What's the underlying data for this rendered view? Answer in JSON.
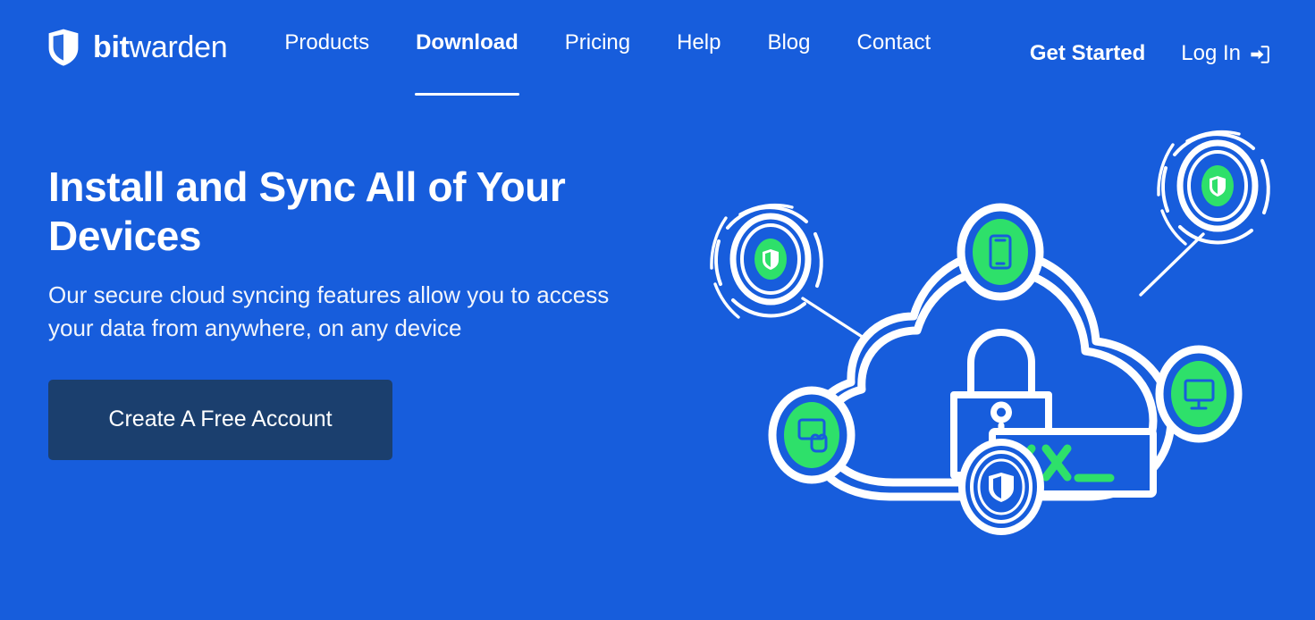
{
  "theme": {
    "background_blue": "#175DDC",
    "button_navy": "#1B3F6E",
    "accent_green": "#2EE06A",
    "text_white": "#FFFFFF"
  },
  "nav": {
    "brand": {
      "bold_part": "bit",
      "light_part": "warden",
      "logo_icon": "bitwarden-shield-icon"
    },
    "links": [
      {
        "label": "Products",
        "active": false
      },
      {
        "label": "Download",
        "active": true
      },
      {
        "label": "Pricing",
        "active": false
      },
      {
        "label": "Help",
        "active": false
      },
      {
        "label": "Blog",
        "active": false
      },
      {
        "label": "Contact",
        "active": false
      }
    ],
    "get_started_label": "Get Started",
    "login_label": "Log In",
    "login_icon": "sign-in-arrow-icon"
  },
  "hero": {
    "title": "Install and Sync All of Your Devices",
    "subtitle": "Our secure cloud syncing features allow you to access your data from anywhere, on any device",
    "cta_label": "Create A Free Account",
    "illustration": {
      "name": "cloud-sync-devices-illustration",
      "password_field_text": "xx_",
      "center_icon": "padlock-icon",
      "nodes": [
        {
          "name": "wireless-shield-node-top-left",
          "icon": "shield-icon",
          "filled": true
        },
        {
          "name": "wireless-shield-node-top-right",
          "icon": "shield-icon",
          "filled": true
        },
        {
          "name": "mobile-device-node",
          "icon": "mobile-phone-icon",
          "filled": true
        },
        {
          "name": "desktop-device-node",
          "icon": "desktop-monitor-icon",
          "filled": true
        },
        {
          "name": "tablet-touch-device-node",
          "icon": "tablet-touch-icon",
          "filled": true
        },
        {
          "name": "shield-ring-node-bottom",
          "icon": "shield-icon",
          "filled": false
        }
      ]
    }
  }
}
